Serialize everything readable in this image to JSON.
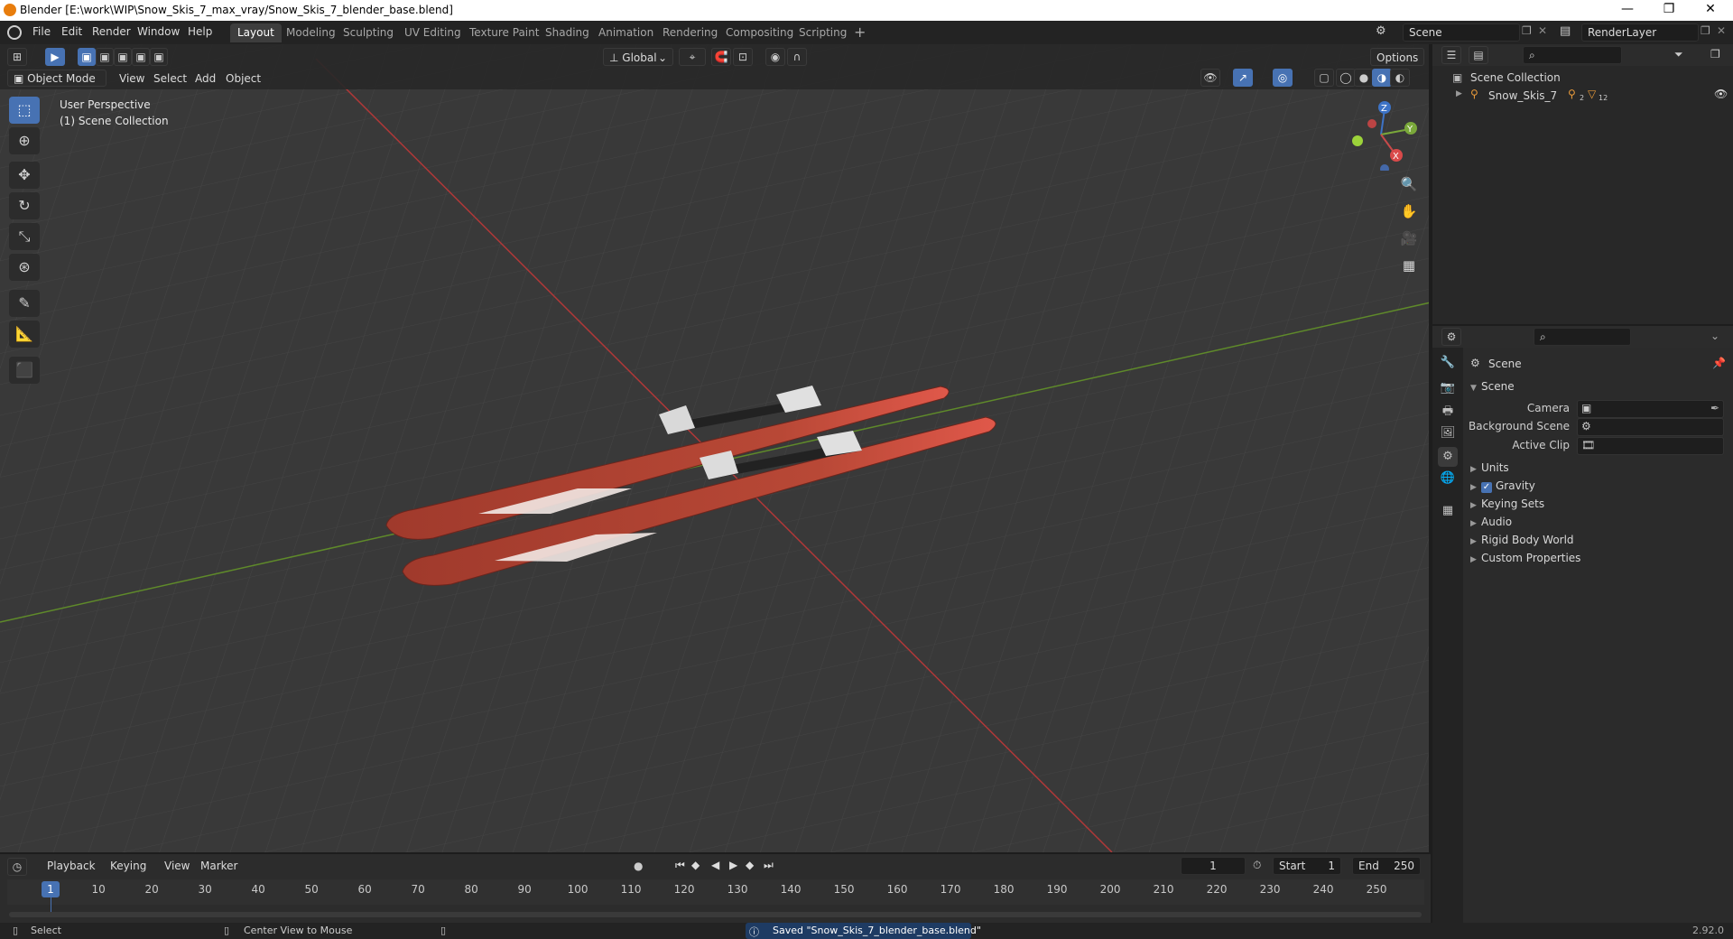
{
  "window": {
    "title": "Blender [E:\\work\\WIP\\Snow_Skis_7_max_vray/Snow_Skis_7_blender_base.blend]",
    "min": "—",
    "max": "❐",
    "close": "✕"
  },
  "menu": [
    "File",
    "Edit",
    "Render",
    "Window",
    "Help"
  ],
  "workspaces": [
    "Layout",
    "Modeling",
    "Sculpting",
    "UV Editing",
    "Texture Paint",
    "Shading",
    "Animation",
    "Rendering",
    "Compositing",
    "Scripting"
  ],
  "active_workspace": "Layout",
  "scene_field": "Scene",
  "renderlayer_field": "RenderLayer",
  "viewport": {
    "transform_orientation": "Global",
    "options_label": "Options",
    "mode": "Object Mode",
    "header_menus": [
      "View",
      "Select",
      "Add",
      "Object"
    ],
    "overlay_line1": "User Perspective",
    "overlay_line2": "(1) Scene Collection",
    "gizmo": {
      "x": "X",
      "y": "Y",
      "z": "Z"
    }
  },
  "outliner": {
    "root": "Scene Collection",
    "items": [
      {
        "name": "Snow_Skis_7",
        "badge1": "2",
        "badge2": "12"
      }
    ]
  },
  "properties": {
    "context": "Scene",
    "panel": "Scene",
    "fields": [
      {
        "label": "Camera"
      },
      {
        "label": "Background Scene"
      },
      {
        "label": "Active Clip"
      }
    ],
    "subpanels": [
      "Units",
      "Gravity",
      "Keying Sets",
      "Audio",
      "Rigid Body World",
      "Custom Properties"
    ],
    "gravity_checked": true
  },
  "timeline": {
    "menus": [
      "Playback",
      "Keying",
      "View",
      "Marker"
    ],
    "current_frame": "1",
    "start_label": "Start",
    "start": "1",
    "end_label": "End",
    "end": "250",
    "ticks": [
      "10",
      "20",
      "30",
      "40",
      "50",
      "60",
      "70",
      "80",
      "90",
      "100",
      "110",
      "120",
      "130",
      "140",
      "150",
      "160",
      "170",
      "180",
      "190",
      "200",
      "210",
      "220",
      "230",
      "240",
      "250"
    ],
    "playhead": "1"
  },
  "status": {
    "select": "Select",
    "center": "Center View to Mouse",
    "message": "Saved \"Snow_Skis_7_blender_base.blend\"",
    "version": "2.92.0"
  },
  "colors": {
    "accent": "#4772b3",
    "x_axis": "#c43a3a",
    "y_axis": "#6a9a2e",
    "ski_red": "#b84836"
  }
}
